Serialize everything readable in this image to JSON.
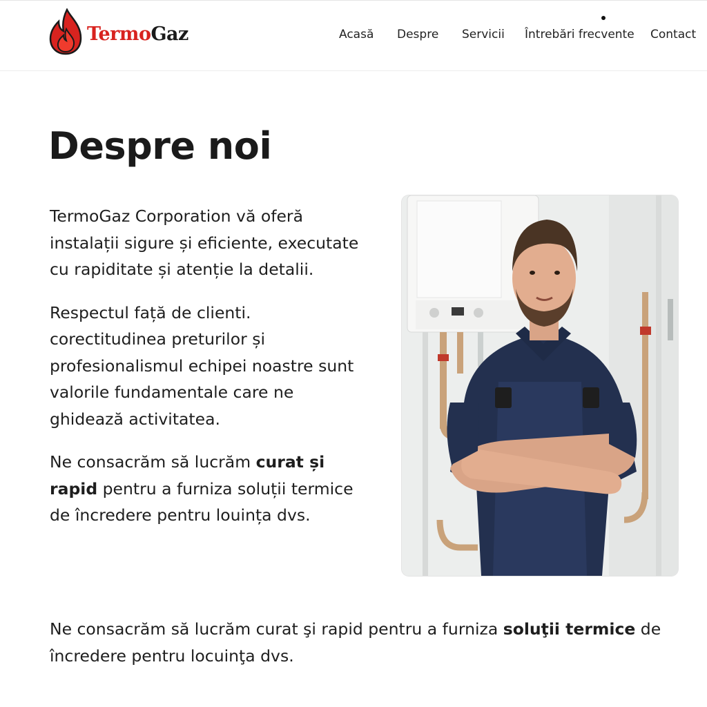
{
  "brand": {
    "name_part1": "Termo",
    "name_part2": "Gaz",
    "red": "#d8231f",
    "dark": "#1a1a1a"
  },
  "nav": {
    "items": [
      {
        "label": "Acasă"
      },
      {
        "label": "Despre"
      },
      {
        "label": "Servicii"
      },
      {
        "label": "Întrebări frecvente"
      },
      {
        "label": "Contact"
      }
    ]
  },
  "main": {
    "title": "Despre noi",
    "p1": "TermoGaz Corporation vă oferă instalații sigure și eficiente, executate cu rapiditate și atenție la detalii.",
    "p2": "Respectul față de clienti. corectitudinea preturilor și profesionalismul echipei noastre sunt valorile fundamentale care ne ghidează activitatea.",
    "p3": {
      "a": "Ne consacrăm să lucrăm ",
      "b": "curat și rapid",
      "c": " pentru a furniza soluții termice de încredere pentru louința dvs."
    },
    "bottom": {
      "a": "Ne consacrăm să lucrăm curat şi rapid pentru a furniza ",
      "b": "soluţii termice",
      "c": " de încredere pentru locuinţa dvs."
    }
  },
  "icons": {
    "logo": "flame-icon"
  }
}
